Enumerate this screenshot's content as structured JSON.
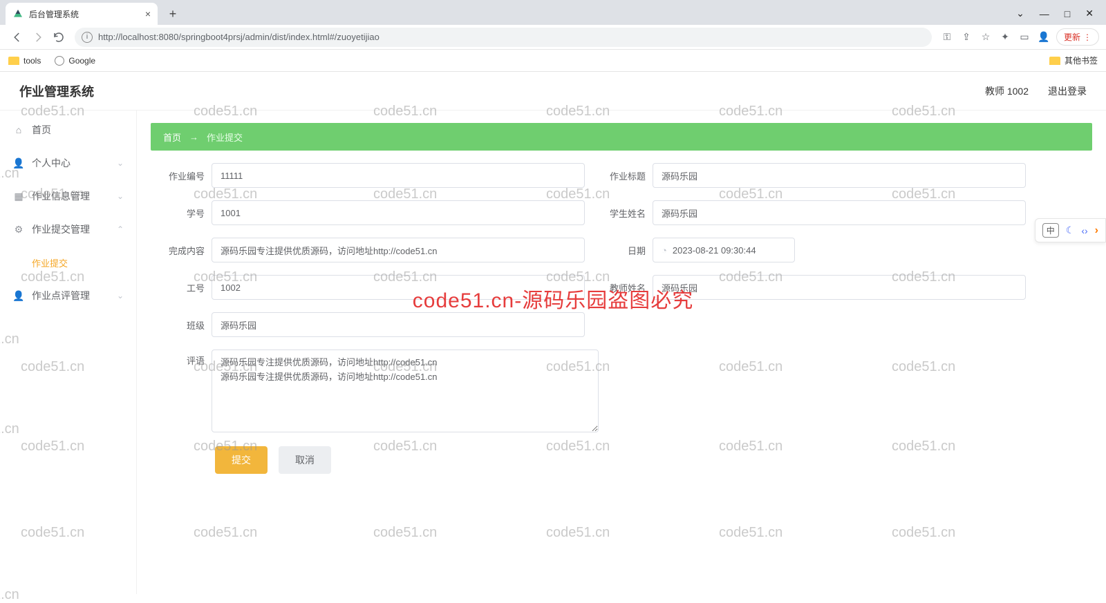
{
  "browser": {
    "tab_title": "后台管理系统",
    "url": "http://localhost:8080/springboot4prsj/admin/dist/index.html#/zuoyetijiao",
    "update_label": "更新",
    "bookmarks": {
      "tools": "tools",
      "google": "Google",
      "other": "其他书签"
    }
  },
  "header": {
    "app_title": "作业管理系统",
    "user_label": "教师 1002",
    "logout": "退出登录"
  },
  "sidebar": {
    "home": "首页",
    "personal": "个人中心",
    "homework_info": "作业信息管理",
    "homework_submit": "作业提交管理",
    "homework_submit_sub": "作业提交",
    "homework_review": "作业点评管理"
  },
  "breadcrumb": {
    "home": "首页",
    "current": "作业提交"
  },
  "form": {
    "labels": {
      "no": "作业编号",
      "title": "作业标题",
      "sno": "学号",
      "sname": "学生姓名",
      "content": "完成内容",
      "date": "日期",
      "tno": "工号",
      "tname": "教师姓名",
      "class": "班级",
      "comment": "评语"
    },
    "values": {
      "no": "11111",
      "title": "源码乐园",
      "sno": "1001",
      "sname": "源码乐园",
      "content": "源码乐园专注提供优质源码，访问地址http://code51.cn",
      "date": "2023-08-21 09:30:44",
      "tno": "1002",
      "tname": "源码乐园",
      "class": "源码乐园",
      "comment": "源码乐园专注提供优质源码，访问地址http://code51.cn\n源码乐园专注提供优质源码，访问地址http://code51.cn"
    },
    "buttons": {
      "submit": "提交",
      "cancel": "取消"
    }
  },
  "watermark": {
    "small": "code51.cn",
    "big": "code51.cn-源码乐园盗图必究"
  },
  "widget": {
    "ime": "中"
  }
}
